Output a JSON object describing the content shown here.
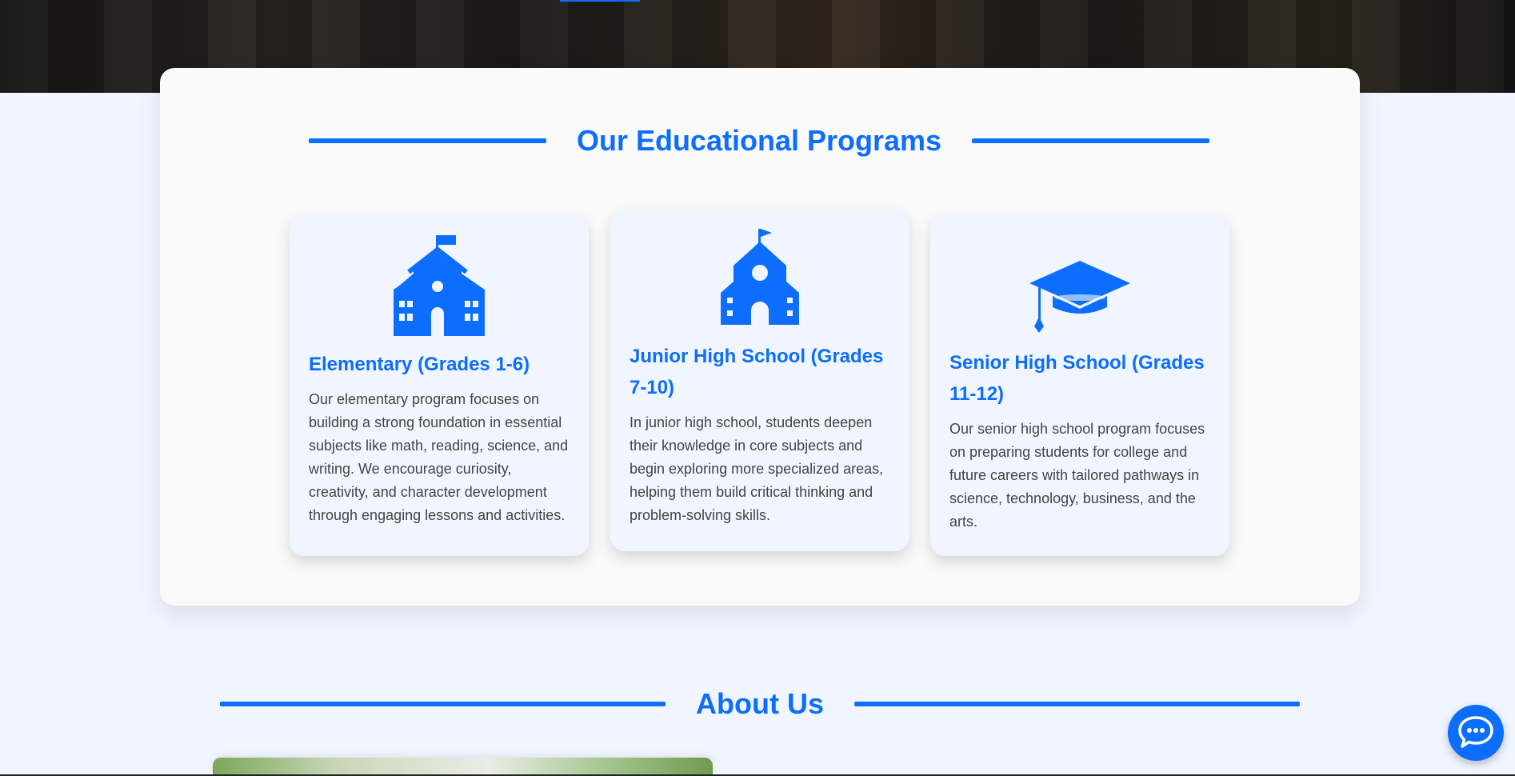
{
  "programs": {
    "heading": "Our Educational Programs",
    "cards": [
      {
        "icon": "school-building-icon",
        "title": "Elementary (Grades 1-6)",
        "description": "Our elementary program focuses on building a strong foundation in essential subjects like math, reading, science, and writing. We encourage curiosity, creativity, and character development through engaging lessons and activities."
      },
      {
        "icon": "schoolhouse-icon",
        "title": "Junior High School (Grades 7-10)",
        "description": "In junior high school, students deepen their knowledge in core subjects and begin exploring more specialized areas, helping them build critical thinking and problem-solving skills."
      },
      {
        "icon": "graduation-cap-icon",
        "title": "Senior High School (Grades 11-12)",
        "description": "Our senior high school program focuses on preparing students for college and future careers with tailored pathways in science, technology, business, and the arts."
      }
    ]
  },
  "about": {
    "heading": "About Us"
  },
  "chat": {
    "icon": "chat-bubble-icon"
  },
  "colors": {
    "accent": "#0d6efd",
    "page_background": "#f0f5ff",
    "panel_background": "#fafafa",
    "body_text": "#444444"
  }
}
